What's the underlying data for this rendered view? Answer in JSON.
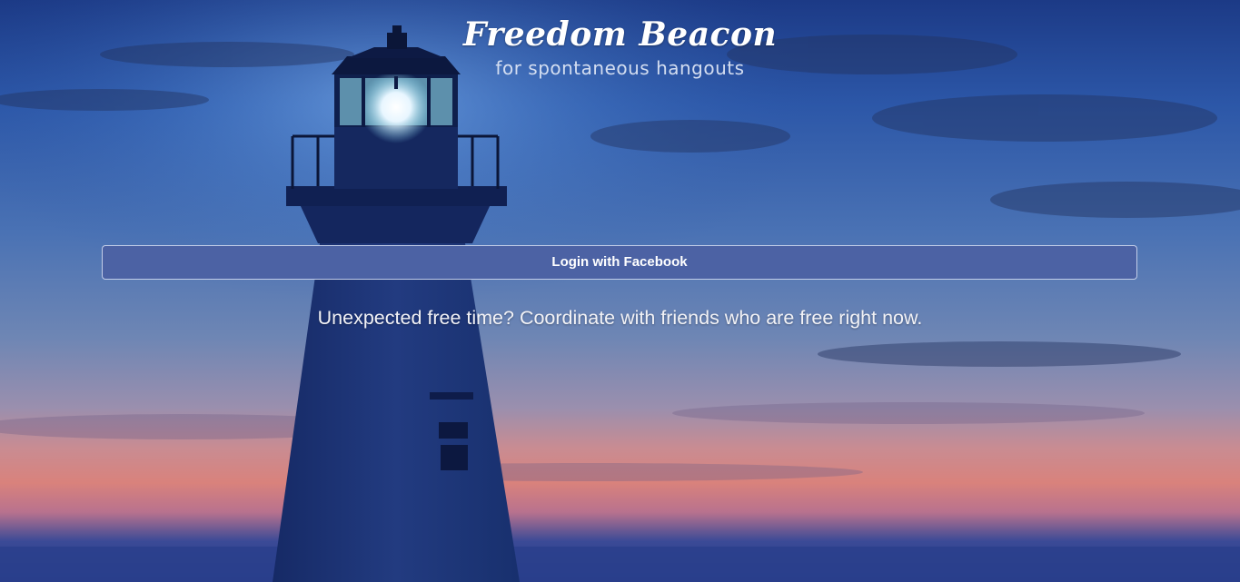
{
  "header": {
    "title": "Freedom Beacon",
    "subtitle": "for spontaneous hangouts"
  },
  "login": {
    "label": "Login with Facebook"
  },
  "main": {
    "tagline": "Unexpected free time? Coordinate with friends who are free right now."
  },
  "colors": {
    "facebook_blue": "#4c62a4",
    "sky_top": "#1e3c88",
    "sky_mid": "#3f6aae",
    "sunset": "#d27a7a"
  },
  "background": {
    "description_icon": "lighthouse-icon"
  }
}
